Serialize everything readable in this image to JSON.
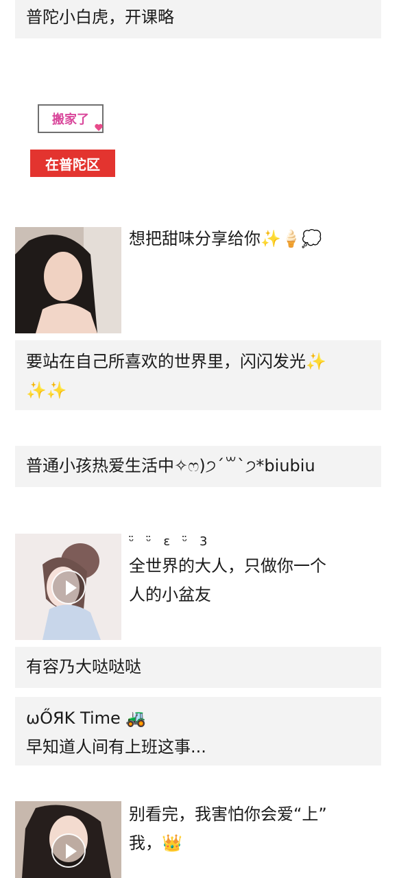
{
  "posts": [
    {
      "text": "普陀小白虎，开课略"
    },
    {
      "sticker_top": "搬家了",
      "sticker_bottom": "在普陀区"
    },
    {
      "caption": "想把甜味分享给你",
      "emojis": "✨🍦💭"
    },
    {
      "lines": [
        "要站在自己所喜欢的世界里，闪闪发光✨",
        "✨✨"
      ]
    },
    {
      "text": "普通小孩热爱生活中✧ෆ)੭ˊ꒳ˋ੭*biubiu"
    },
    {
      "lines": [
        "ᵕ̈ ᵕ̈ ε ᵕ̈ 3",
        "全世界的大人，只做你一个",
        "人的小盆友"
      ]
    },
    {
      "text": "有容乃大哒哒哒"
    },
    {
      "lines": [
        "ωŐЯK Time 🚜",
        "早知道人间有上班这事..."
      ]
    },
    {
      "lines": [
        "别看完，我害怕你会爱“上”",
        "我，👑"
      ]
    }
  ]
}
